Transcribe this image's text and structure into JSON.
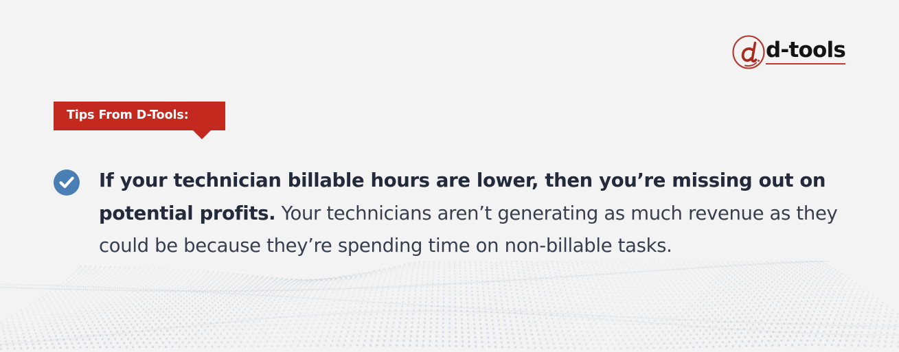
{
  "page": {
    "background_color": "#f3f3f3",
    "accent_red": "#c4291f",
    "accent_blue": "#4a7fb5",
    "text_color": "#2b3244"
  },
  "logo": {
    "mark_name": "d-tools-monogram-icon",
    "mark_letter": "d",
    "wordmark": "d-tools",
    "underline_color": "#c0392b"
  },
  "banner": {
    "label": "Tips From D-Tools:",
    "background_color": "#c4291f",
    "text_color": "#ffffff"
  },
  "tip": {
    "check_icon": "check-circle-icon",
    "check_icon_color": "#4a7fb5",
    "bold_text": "If your technician billable hours are lower, then you’re missing out on potential profits.",
    "body_text": " Your technicians aren’t generating as much revenue as they could be because they’re spending time on non-billable tasks."
  },
  "decoration": {
    "wave_name": "dotted-wave-graphic",
    "dot_color": "#9fb6ce"
  }
}
